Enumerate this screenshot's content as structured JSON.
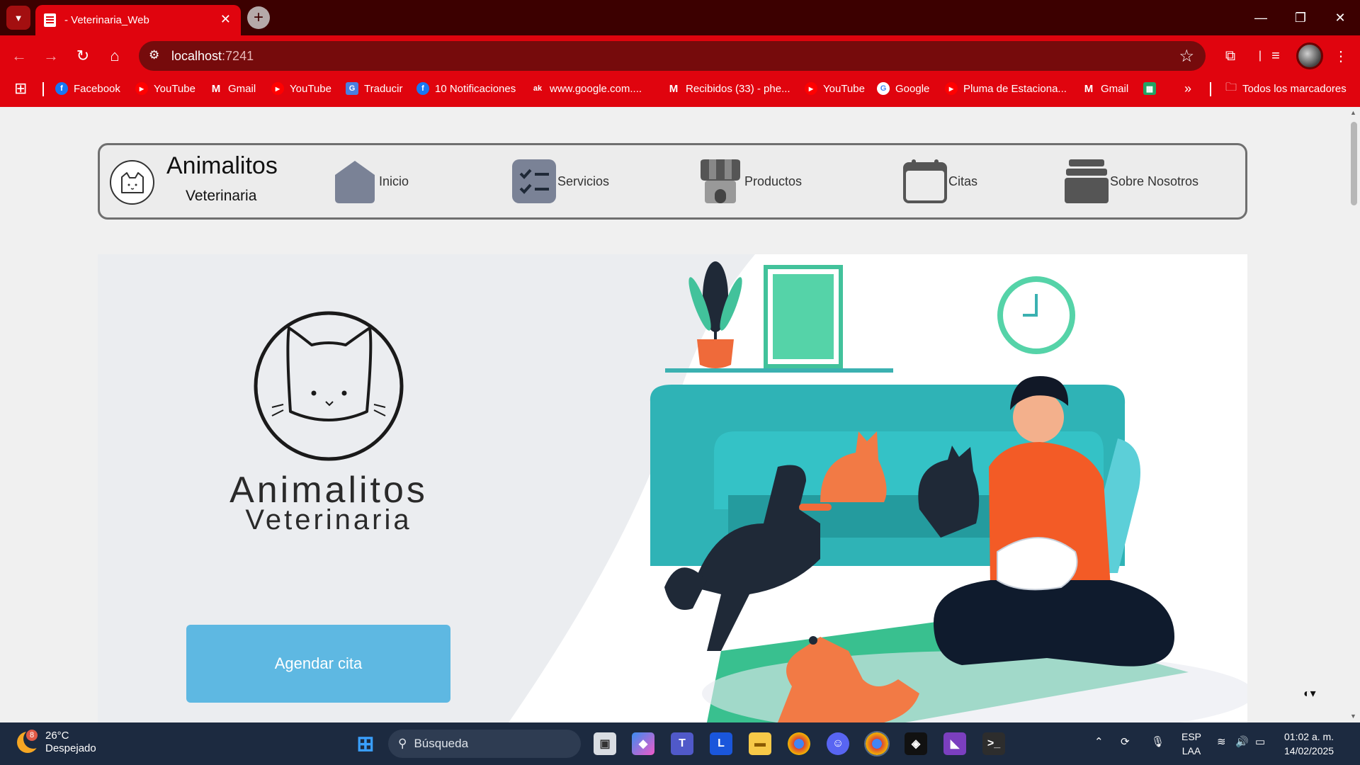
{
  "browser": {
    "tab_title": "- Veterinaria_Web",
    "tab_close": "✕",
    "new_tab": "+",
    "url_host": "localhost",
    "url_port": ":7241",
    "window_controls": {
      "minimize": "—",
      "restore": "❐",
      "close": "✕"
    }
  },
  "bookmarks": {
    "items": [
      {
        "label": "Facebook",
        "icon": "facebook-icon"
      },
      {
        "label": "YouTube",
        "icon": "youtube-icon"
      },
      {
        "label": "Gmail",
        "icon": "gmail-icon"
      },
      {
        "label": "YouTube",
        "icon": "youtube-icon"
      },
      {
        "label": "Traducir",
        "icon": "translate-icon"
      },
      {
        "label": "10 Notificaciones",
        "icon": "facebook-icon"
      },
      {
        "label": "www.google.com....",
        "icon": "akamai-icon"
      },
      {
        "label": "Recibidos (33) - phe...",
        "icon": "gmail-icon"
      },
      {
        "label": "YouTube",
        "icon": "youtube-icon"
      },
      {
        "label": "Google",
        "icon": "google-icon"
      },
      {
        "label": "Pluma de Estaciona...",
        "icon": "youtube-icon"
      },
      {
        "label": "Gmail",
        "icon": "gmail-icon"
      }
    ],
    "all_bookmarks": "Todos los marcadores",
    "more": "»"
  },
  "site": {
    "brand_name": "Animalitos",
    "brand_sub": "Veterinaria",
    "nav": [
      {
        "label": "Inicio"
      },
      {
        "label": "Servicios"
      },
      {
        "label": "Productos"
      },
      {
        "label": "Citas"
      },
      {
        "label": "Sobre Nosotros"
      }
    ],
    "hero_logo_title": "Animalitos",
    "hero_logo_sub": "Veterinaria",
    "cta_label": "Agendar cita",
    "theme_toggle": "◐▾"
  },
  "colors": {
    "browser_red": "#e0040e",
    "titlebar": "#3c0000",
    "cta_blue": "#5eb8e2",
    "taskbar": "#1c2a40"
  },
  "taskbar": {
    "temperature": "26°C",
    "weather": "Despejado",
    "weather_badge": "8",
    "search_placeholder": "Búsqueda",
    "lang_top": "ESP",
    "lang_bottom": "LAA",
    "time": "01:02 a. m.",
    "date": "14/02/2025"
  }
}
